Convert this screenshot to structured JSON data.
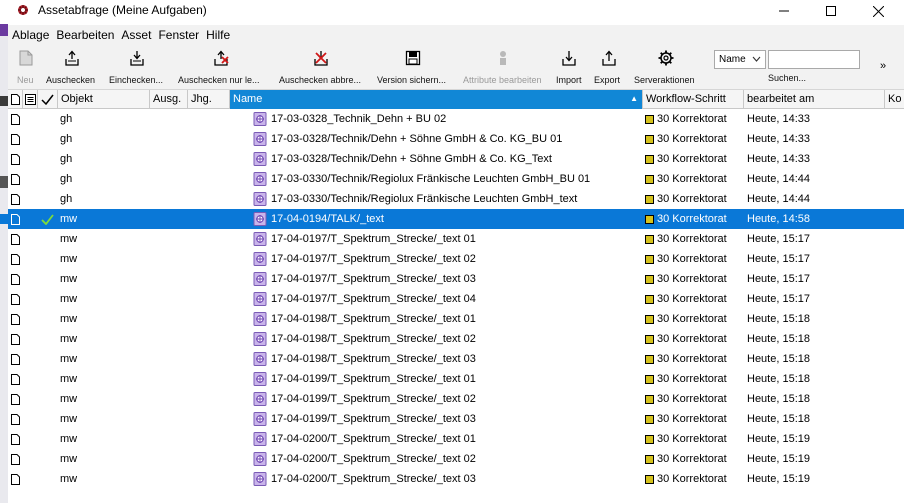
{
  "window": {
    "title": "Assetabfrage (Meine Aufgaben)",
    "controls": [
      "minimize",
      "maximize",
      "close"
    ]
  },
  "menu": [
    "Ablage",
    "Bearbeiten",
    "Asset",
    "Fenster",
    "Hilfe"
  ],
  "toolbar": {
    "buttons": [
      {
        "label": "Neu",
        "icon": "new-doc-icon",
        "enabled": false
      },
      {
        "label": "Auschecken",
        "icon": "checkout-icon",
        "enabled": true
      },
      {
        "label": "Einchecken...",
        "icon": "checkin-icon",
        "enabled": true
      },
      {
        "label": "Auschecken nur le...",
        "icon": "checkout-readonly-icon",
        "enabled": true
      },
      {
        "label": "Auschecken abbre...",
        "icon": "cancel-checkout-icon",
        "enabled": true
      },
      {
        "label": "Version sichern...",
        "icon": "save-icon",
        "enabled": true
      },
      {
        "label": "Attribute bearbeiten",
        "icon": "attributes-icon",
        "enabled": false
      },
      {
        "label": "Import",
        "icon": "import-icon",
        "enabled": true
      },
      {
        "label": "Export",
        "icon": "export-icon",
        "enabled": true
      },
      {
        "label": "Serveraktionen",
        "icon": "gear-icon",
        "enabled": true
      }
    ],
    "search": {
      "field_value": "Name",
      "label": "Suchen...",
      "more": "»"
    }
  },
  "table": {
    "columns": [
      "Objekt",
      "Ausg.",
      "Jhg.",
      "Name",
      "Workflow-Schritt",
      "bearbeitet am",
      "Ko"
    ],
    "sort_arrow": "▲",
    "status_color": "#d5c21c",
    "selection_color": "#0a78d7",
    "rows": [
      {
        "objekt": "gh",
        "name": "17-03-0328_Technik_Dehn + BU 02",
        "workflow": "30 Korrektorat",
        "date": "Heute, 14:33",
        "checked": false,
        "selected": false
      },
      {
        "objekt": "gh",
        "name": "17-03-0328/Technik/Dehn + Söhne GmbH & Co. KG_BU 01",
        "workflow": "30 Korrektorat",
        "date": "Heute, 14:33",
        "checked": false,
        "selected": false
      },
      {
        "objekt": "gh",
        "name": "17-03-0328/Technik/Dehn + Söhne GmbH & Co. KG_Text",
        "workflow": "30 Korrektorat",
        "date": "Heute, 14:33",
        "checked": false,
        "selected": false
      },
      {
        "objekt": "gh",
        "name": "17-03-0330/Technik/Regiolux Fränkische Leuchten GmbH_BU 01",
        "workflow": "30 Korrektorat",
        "date": "Heute, 14:44",
        "checked": false,
        "selected": false
      },
      {
        "objekt": "gh",
        "name": "17-03-0330/Technik/Regiolux Fränkische Leuchten GmbH_text",
        "workflow": "30 Korrektorat",
        "date": "Heute, 14:44",
        "checked": false,
        "selected": false
      },
      {
        "objekt": "mw",
        "name": "17-04-0194/TALK/_text",
        "workflow": "30 Korrektorat",
        "date": "Heute, 14:58",
        "checked": true,
        "selected": true
      },
      {
        "objekt": "mw",
        "name": "17-04-0197/T_Spektrum_Strecke/_text 01",
        "workflow": "30 Korrektorat",
        "date": "Heute, 15:17",
        "checked": false,
        "selected": false
      },
      {
        "objekt": "mw",
        "name": "17-04-0197/T_Spektrum_Strecke/_text 02",
        "workflow": "30 Korrektorat",
        "date": "Heute, 15:17",
        "checked": false,
        "selected": false
      },
      {
        "objekt": "mw",
        "name": "17-04-0197/T_Spektrum_Strecke/_text 03",
        "workflow": "30 Korrektorat",
        "date": "Heute, 15:17",
        "checked": false,
        "selected": false
      },
      {
        "objekt": "mw",
        "name": "17-04-0197/T_Spektrum_Strecke/_text 04",
        "workflow": "30 Korrektorat",
        "date": "Heute, 15:17",
        "checked": false,
        "selected": false
      },
      {
        "objekt": "mw",
        "name": "17-04-0198/T_Spektrum_Strecke/_text 01",
        "workflow": "30 Korrektorat",
        "date": "Heute, 15:18",
        "checked": false,
        "selected": false
      },
      {
        "objekt": "mw",
        "name": "17-04-0198/T_Spektrum_Strecke/_text 02",
        "workflow": "30 Korrektorat",
        "date": "Heute, 15:18",
        "checked": false,
        "selected": false
      },
      {
        "objekt": "mw",
        "name": "17-04-0198/T_Spektrum_Strecke/_text 03",
        "workflow": "30 Korrektorat",
        "date": "Heute, 15:18",
        "checked": false,
        "selected": false
      },
      {
        "objekt": "mw",
        "name": "17-04-0199/T_Spektrum_Strecke/_text 01",
        "workflow": "30 Korrektorat",
        "date": "Heute, 15:18",
        "checked": false,
        "selected": false
      },
      {
        "objekt": "mw",
        "name": "17-04-0199/T_Spektrum_Strecke/_text 02",
        "workflow": "30 Korrektorat",
        "date": "Heute, 15:18",
        "checked": false,
        "selected": false
      },
      {
        "objekt": "mw",
        "name": "17-04-0199/T_Spektrum_Strecke/_text 03",
        "workflow": "30 Korrektorat",
        "date": "Heute, 15:18",
        "checked": false,
        "selected": false
      },
      {
        "objekt": "mw",
        "name": "17-04-0200/T_Spektrum_Strecke/_text 01",
        "workflow": "30 Korrektorat",
        "date": "Heute, 15:19",
        "checked": false,
        "selected": false
      },
      {
        "objekt": "mw",
        "name": "17-04-0200/T_Spektrum_Strecke/_text 02",
        "workflow": "30 Korrektorat",
        "date": "Heute, 15:19",
        "checked": false,
        "selected": false
      },
      {
        "objekt": "mw",
        "name": "17-04-0200/T_Spektrum_Strecke/_text 03",
        "workflow": "30 Korrektorat",
        "date": "Heute, 15:19",
        "checked": false,
        "selected": false
      }
    ]
  }
}
